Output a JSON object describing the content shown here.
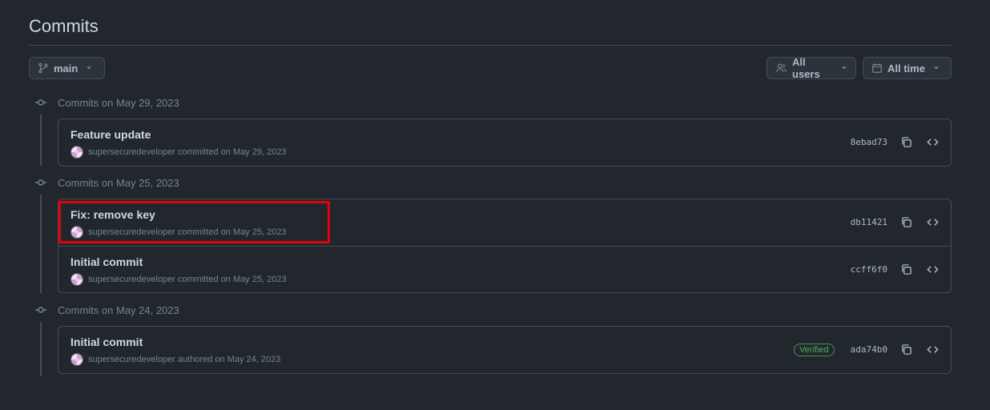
{
  "page": {
    "title": "Commits"
  },
  "filters": {
    "branch_label": "main",
    "users_label": "All users",
    "time_label": "All time"
  },
  "groups": [
    {
      "heading": "Commits on May 29, 2023",
      "commits": [
        {
          "message": "Feature update",
          "meta": "supersecuredeveloper committed on May 29, 2023",
          "sha": "8ebad73",
          "verified": false
        }
      ]
    },
    {
      "heading": "Commits on May 25, 2023",
      "commits": [
        {
          "message": "Fix: remove key",
          "meta": "supersecuredeveloper committed on May 25, 2023",
          "sha": "db11421",
          "verified": false
        },
        {
          "message": "Initial commit",
          "meta": "supersecuredeveloper committed on May 25, 2023",
          "sha": "ccff6f0",
          "verified": false
        }
      ]
    },
    {
      "heading": "Commits on May 24, 2023",
      "commits": [
        {
          "message": "Initial commit",
          "meta": "supersecuredeveloper authored on May 24, 2023",
          "sha": "ada74b0",
          "verified": true,
          "verified_label": "Verified"
        }
      ]
    }
  ],
  "colors": {
    "background": "#22272e",
    "border": "#444c56",
    "verified": "#57ab5a",
    "highlight": "#e5000a"
  }
}
